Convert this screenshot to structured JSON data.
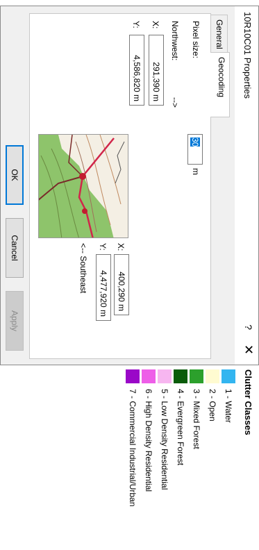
{
  "dialog": {
    "title": "10R10C01 Properties",
    "help_label": "?",
    "close_label": "✕",
    "tabs": [
      "General",
      "Geocoding"
    ],
    "pixel_size_label": "Pixel size:",
    "pixel_size_value": "30",
    "pixel_size_unit": "m",
    "northwest_label": "Northwest:",
    "northwest_arrow": "-->",
    "nw_x_label": "X:",
    "nw_x_value": "291,390 m",
    "nw_y_label": "Y:",
    "nw_y_value": "4,586,820 m",
    "se_x_label": "X:",
    "se_x_value": "400,290 m",
    "se_y_label": "Y:",
    "se_y_value": "4,477,920 m",
    "southeast_label": "<-- Southeast",
    "buttons": {
      "ok": "OK",
      "cancel": "Cancel",
      "apply": "Apply"
    }
  },
  "legend": {
    "title": "Clutter Classes",
    "items": [
      {
        "label": "1 - Water",
        "color": "#33b5f0"
      },
      {
        "label": "2 - Open",
        "color": "#fffbd1"
      },
      {
        "label": "3 - Mixed Forest",
        "color": "#2ca02c"
      },
      {
        "label": "4 - Evergreen Forest",
        "color": "#0a5c0a"
      },
      {
        "label": "5 - Low Density Residential",
        "color": "#f7b6f0"
      },
      {
        "label": "6 - High Density Residential",
        "color": "#ee5ee8"
      },
      {
        "label": "7 - Commercial Industrial/Urban",
        "color": "#9a08c8"
      }
    ]
  }
}
